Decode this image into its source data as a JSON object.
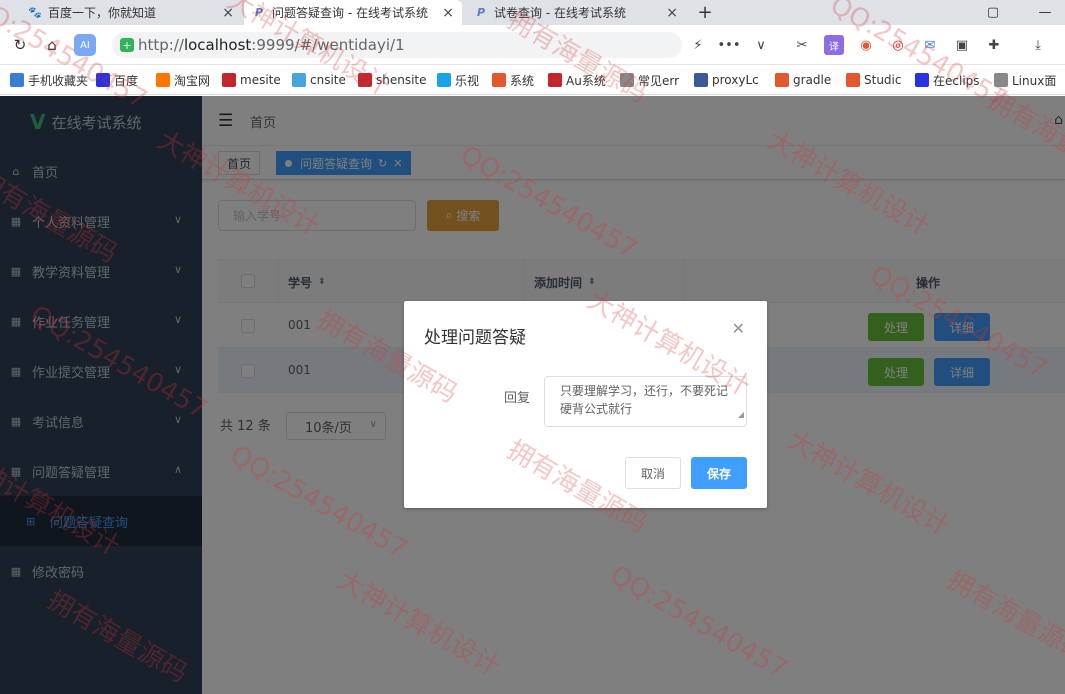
{
  "browser": {
    "tabs": [
      {
        "label": "百度一下，你就知道",
        "icon": "baidu-icon",
        "active": false
      },
      {
        "label": "问题答疑查询 - 在线考试系统",
        "icon": "p-logo-icon",
        "active": true
      },
      {
        "label": "试卷查询 - 在线考试系统",
        "icon": "p-logo-icon",
        "active": false
      }
    ],
    "url_prefix": "http://",
    "url_host": "localhost",
    "url_rest": ":9999/#/wentidayi/1",
    "bookmarks": [
      {
        "label": "手机收藏夹",
        "color": "#3a7bd5"
      },
      {
        "label": "百度",
        "color": "#2932e1"
      },
      {
        "label": "淘宝网",
        "color": "#ff7700"
      },
      {
        "label": "mesite",
        "color": "#c1272d"
      },
      {
        "label": "cnsite",
        "color": "#4aa3df"
      },
      {
        "label": "shensite",
        "color": "#c1272d"
      },
      {
        "label": "乐视",
        "color": "#1aa3e8"
      },
      {
        "label": "系统",
        "color": "#e2572b"
      },
      {
        "label": "Au系统",
        "color": "#c1272d"
      },
      {
        "label": "常见err",
        "color": "#888888"
      },
      {
        "label": "proxyLc",
        "color": "#3b5998"
      },
      {
        "label": "gradle",
        "color": "#e2572b"
      },
      {
        "label": "Studic",
        "color": "#e2572b"
      },
      {
        "label": "在eclips",
        "color": "#2932e1"
      },
      {
        "label": "Linux面",
        "color": "#888888"
      }
    ]
  },
  "app": {
    "logo": "在线考试系统",
    "menu": [
      {
        "label": "首页",
        "icon": "home-icon",
        "arrow": ""
      },
      {
        "label": "个人资料管理",
        "icon": "grid-icon",
        "arrow": "∨"
      },
      {
        "label": "教学资料管理",
        "icon": "grid-icon",
        "arrow": "∨"
      },
      {
        "label": "作业任务管理",
        "icon": "grid-icon",
        "arrow": "∨"
      },
      {
        "label": "作业提交管理",
        "icon": "grid-icon",
        "arrow": "∨"
      },
      {
        "label": "考试信息",
        "icon": "grid-icon",
        "arrow": "∨"
      },
      {
        "label": "问题答疑管理",
        "icon": "grid-icon",
        "arrow": "∧"
      },
      {
        "label": "修改密码",
        "icon": "grid-icon",
        "arrow": ""
      }
    ],
    "submenu_active": "问题答疑查询",
    "breadcrumb": "首页",
    "tags": [
      "首页",
      "问题答疑查询"
    ],
    "search_placeholder": "输入学号",
    "search_button": "搜索",
    "table": {
      "headers": [
        "学号",
        "添加时间",
        "操作"
      ],
      "rows": [
        {
          "id": "001",
          "time": ""
        },
        {
          "id": "001",
          "time": ""
        }
      ],
      "handle_label": "处理",
      "detail_label": "详细"
    },
    "pager": {
      "total": "共 12 条",
      "size": "10条/页"
    }
  },
  "dialog": {
    "title": "处理问题答疑",
    "label": "回复",
    "reply": "只要理解学习，还行，不要死记硬背公式就行",
    "cancel": "取消",
    "save": "保存"
  },
  "watermark": [
    "QQ:254540457",
    "大神计算机设计",
    "拥有海量源码"
  ],
  "colors": {
    "primary": "#409eff",
    "success": "#67c23a",
    "warning": "#e6a23c",
    "sidebar": "#304156"
  }
}
